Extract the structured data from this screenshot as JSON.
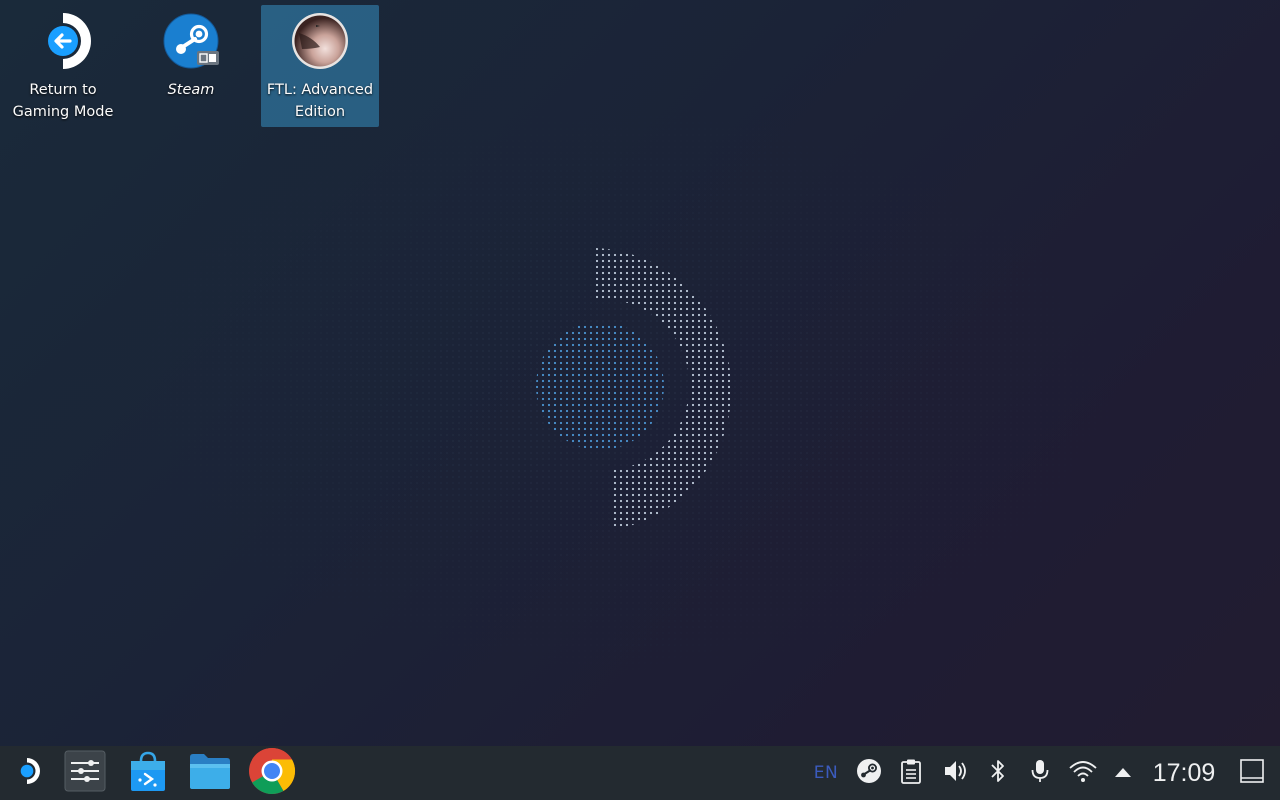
{
  "desktop": {
    "icons": [
      {
        "label": "Return to Gaming Mode",
        "icon": "return-arrow-icon"
      },
      {
        "label": "Steam",
        "icon": "steam-icon"
      },
      {
        "label": "FTL: Advanced Edition",
        "icon": "ftl-game-icon",
        "selected": true
      }
    ]
  },
  "taskbar": {
    "launchers": [
      "steam-deck-menu-icon",
      "settings-sliders-icon",
      "discover-store-icon",
      "file-manager-icon",
      "chrome-icon"
    ],
    "tray": {
      "keyboard_layout": "EN",
      "icons": [
        "steam-tray-icon",
        "clipboard-icon",
        "volume-icon",
        "bluetooth-icon",
        "microphone-icon",
        "wifi-icon",
        "expand-tray-arrow-icon"
      ],
      "clock": "17:09"
    }
  },
  "colors": {
    "accent": "#3daee9",
    "taskbar_bg": "#232a30",
    "keyboard_layout_text": "#3b5bbd"
  }
}
